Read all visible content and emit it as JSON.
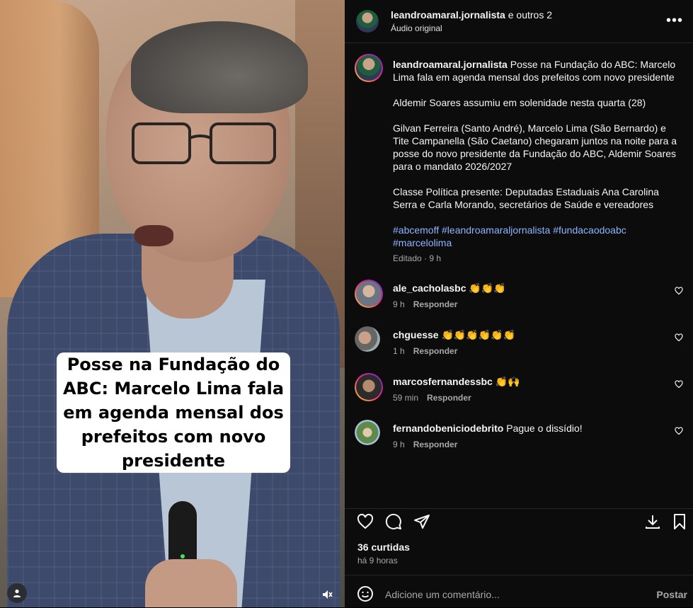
{
  "video": {
    "caption_text": "Posse na Fundação do ABC: Marcelo Lima fala em agenda mensal dos prefeitos com novo presidente"
  },
  "header": {
    "username": "leandroamaral.jornalista",
    "others": "e outros 2",
    "audio": "Áudio original",
    "more": "•••"
  },
  "caption": {
    "username": "leandroamaral.jornalista",
    "title": "Posse na Fundação do ABC: Marcelo Lima fala em agenda mensal dos prefeitos com novo presidente",
    "para1": "Aldemir Soares assumiu em solenidade nesta quarta (28)",
    "para2": "Gilvan Ferreira (Santo André), Marcelo Lima (São Bernardo) e Tite Campanella (São Caetano) chegaram juntos na noite para a posse do novo presidente da Fundação do ABC, Aldemir Soares para o mandato 2026/2027",
    "para3": "Classe Política presente: Deputadas Estaduais Ana Carolina Serra e Carla Morando, secretários de Saúde e vereadores",
    "hashtags": [
      "#abcemoff",
      "#leandroamaraljornalista",
      "#fundacaodoabc",
      "#marcelolima"
    ],
    "edited": "Editado · 9 h"
  },
  "comments": [
    {
      "user": "ale_cacholasbc",
      "text": "👏👏👏",
      "time": "9 h",
      "reply": "Responder"
    },
    {
      "user": "chguesse",
      "text": "👏👏👏👏👏👏",
      "time": "1 h",
      "reply": "Responder"
    },
    {
      "user": "marcosfernandessbc",
      "text": "👏🙌",
      "time": "59 min",
      "reply": "Responder"
    },
    {
      "user": "fernandobeniciodebrito",
      "text": "Pague o dissídio!",
      "time": "9 h",
      "reply": "Responder"
    }
  ],
  "stats": {
    "likes": "36 curtidas",
    "time": "há 9 horas"
  },
  "add_comment": {
    "placeholder": "Adicione um comentário...",
    "post": "Postar"
  },
  "icons": [
    "heart-icon",
    "comment-icon",
    "share-icon",
    "download-icon",
    "bookmark-icon",
    "emoji-icon",
    "muted-speaker-icon",
    "user-tag-icon"
  ]
}
